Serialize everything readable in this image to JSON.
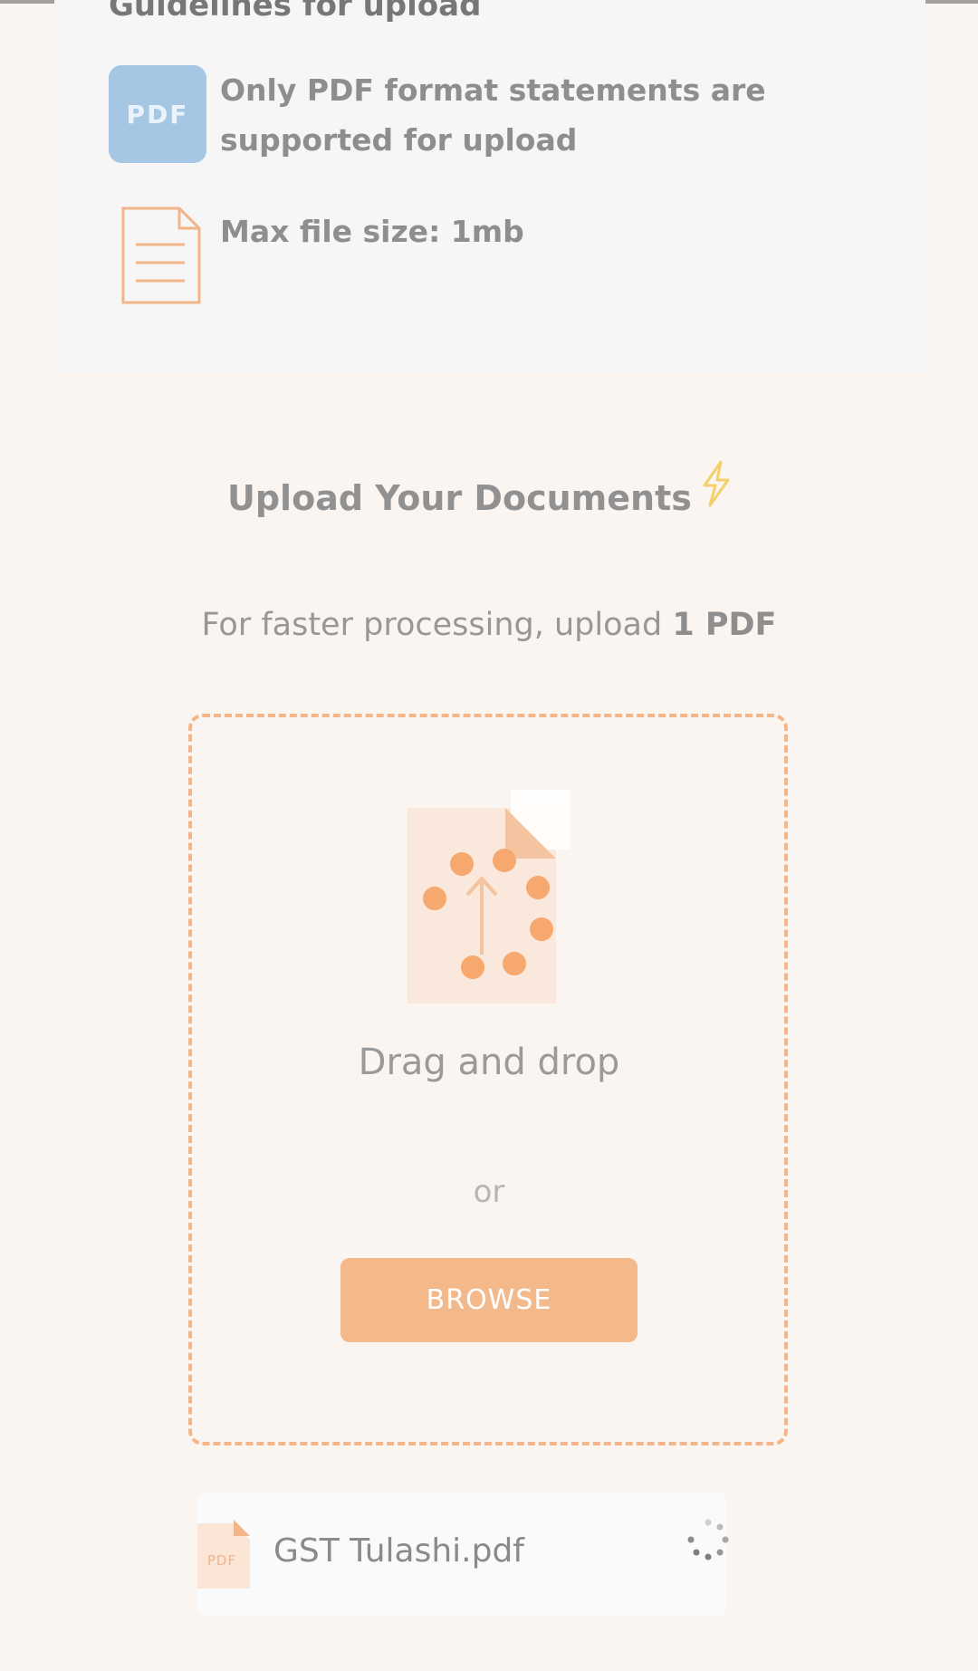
{
  "guidelines": {
    "heading": "Guidelines for upload",
    "pdf_badge": "PDF",
    "items": [
      {
        "icon": "pdf-icon",
        "text": "Only PDF format statements are supported for upload"
      },
      {
        "icon": "document-icon",
        "text": "Max file size: 1mb"
      }
    ]
  },
  "upload": {
    "title": "Upload Your Documents",
    "title_icon": "lightning-icon",
    "subtitle_prefix": "For faster processing, upload ",
    "subtitle_bold": "1 PDF",
    "drag_text": "Drag and drop",
    "or_text": "or",
    "browse_label": "BROWSE"
  },
  "file": {
    "icon_label": "PDF",
    "name": "GST Tulashi.pdf",
    "status_icon": "loading-spinner-icon"
  },
  "colors": {
    "accent": "#f4b98b",
    "background": "#fbf5f1",
    "pdf_blue": "#a5c7e4"
  }
}
